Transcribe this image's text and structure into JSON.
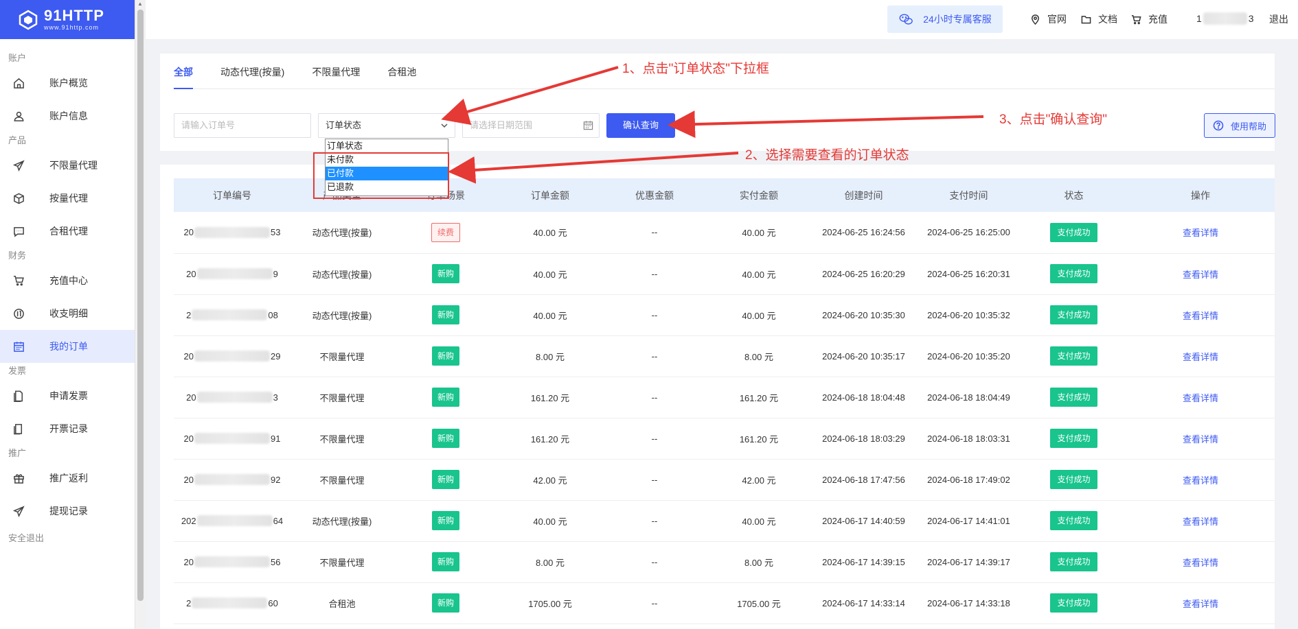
{
  "brand": {
    "name": "91HTTP",
    "url_text": "www.91http.com"
  },
  "topbar": {
    "service": "24小时专属客服",
    "links": [
      "官网",
      "文档",
      "充值"
    ],
    "user_id_start": "1",
    "user_id_end": "3",
    "logout": "退出"
  },
  "sidebar": {
    "groups": [
      {
        "label": "账户",
        "items": [
          {
            "label": "账户概览",
            "icon": "home-icon"
          },
          {
            "label": "账户信息",
            "icon": "user-icon"
          }
        ]
      },
      {
        "label": "产品",
        "items": [
          {
            "label": "不限量代理",
            "icon": "send-icon"
          },
          {
            "label": "按量代理",
            "icon": "box-icon"
          },
          {
            "label": "合租代理",
            "icon": "chat-icon"
          }
        ]
      },
      {
        "label": "财务",
        "items": [
          {
            "label": "充值中心",
            "icon": "cart-icon"
          },
          {
            "label": "收支明细",
            "icon": "coin-icon"
          },
          {
            "label": "我的订单",
            "icon": "calendar-icon",
            "active": true
          }
        ]
      },
      {
        "label": "发票",
        "items": [
          {
            "label": "申请发票",
            "icon": "doc-icon"
          },
          {
            "label": "开票记录",
            "icon": "record-icon"
          }
        ]
      },
      {
        "label": "推广",
        "items": [
          {
            "label": "推广返利",
            "icon": "gift-icon"
          },
          {
            "label": "提现记录",
            "icon": "send-icon"
          }
        ]
      }
    ],
    "footer": "安全退出"
  },
  "tabs": [
    "全部",
    "动态代理(按量)",
    "不限量代理",
    "合租池"
  ],
  "filters": {
    "order_no_placeholder": "请输入订单号",
    "status_value": "订单状态",
    "date_placeholder": "请选择日期范围",
    "confirm": "确认查询",
    "help": "使用帮助"
  },
  "dropdown": {
    "options": [
      "订单状态",
      "未付款",
      "已付款",
      "已退款"
    ],
    "selected_index": 2
  },
  "annotations": {
    "step1": "1、点击\"订单状态\"下拉框",
    "step2": "2、选择需要查看的订单状态",
    "step3": "3、点击\"确认查询\""
  },
  "table": {
    "columns": [
      "订单编号",
      "产品类型",
      "订单场景",
      "订单金额",
      "优惠金额",
      "实付金额",
      "创建时间",
      "支付时间",
      "状态",
      "操作"
    ],
    "rows": [
      {
        "no_start": "20",
        "no_end": "53",
        "product": "动态代理(按量)",
        "scene": "续费",
        "amount": "40.00 元",
        "discount": "--",
        "paid": "40.00 元",
        "created": "2024-06-25 16:24:56",
        "pay_time": "2024-06-25 16:25:00",
        "status": "支付成功",
        "action": "查看详情"
      },
      {
        "no_start": "20",
        "no_end": "9",
        "product": "动态代理(按量)",
        "scene": "新购",
        "amount": "40.00 元",
        "discount": "--",
        "paid": "40.00 元",
        "created": "2024-06-25 16:20:29",
        "pay_time": "2024-06-25 16:20:31",
        "status": "支付成功",
        "action": "查看详情"
      },
      {
        "no_start": "2",
        "no_end": "08",
        "product": "动态代理(按量)",
        "scene": "新购",
        "amount": "40.00 元",
        "discount": "--",
        "paid": "40.00 元",
        "created": "2024-06-20 10:35:30",
        "pay_time": "2024-06-20 10:35:32",
        "status": "支付成功",
        "action": "查看详情"
      },
      {
        "no_start": "20",
        "no_end": "29",
        "product": "不限量代理",
        "scene": "新购",
        "amount": "8.00 元",
        "discount": "--",
        "paid": "8.00 元",
        "created": "2024-06-20 10:35:17",
        "pay_time": "2024-06-20 10:35:20",
        "status": "支付成功",
        "action": "查看详情"
      },
      {
        "no_start": "20",
        "no_end": "3",
        "product": "不限量代理",
        "scene": "新购",
        "amount": "161.20 元",
        "discount": "--",
        "paid": "161.20 元",
        "created": "2024-06-18 18:04:48",
        "pay_time": "2024-06-18 18:04:49",
        "status": "支付成功",
        "action": "查看详情"
      },
      {
        "no_start": "20",
        "no_end": "91",
        "product": "不限量代理",
        "scene": "新购",
        "amount": "161.20 元",
        "discount": "--",
        "paid": "161.20 元",
        "created": "2024-06-18 18:03:29",
        "pay_time": "2024-06-18 18:03:31",
        "status": "支付成功",
        "action": "查看详情"
      },
      {
        "no_start": "20",
        "no_end": "92",
        "product": "不限量代理",
        "scene": "新购",
        "amount": "42.00 元",
        "discount": "--",
        "paid": "42.00 元",
        "created": "2024-06-18 17:47:56",
        "pay_time": "2024-06-18 17:49:02",
        "status": "支付成功",
        "action": "查看详情"
      },
      {
        "no_start": "202",
        "no_end": "64",
        "product": "动态代理(按量)",
        "scene": "新购",
        "amount": "40.00 元",
        "discount": "--",
        "paid": "40.00 元",
        "created": "2024-06-17 14:40:59",
        "pay_time": "2024-06-17 14:41:01",
        "status": "支付成功",
        "action": "查看详情"
      },
      {
        "no_start": "20",
        "no_end": "56",
        "product": "不限量代理",
        "scene": "新购",
        "amount": "8.00 元",
        "discount": "--",
        "paid": "8.00 元",
        "created": "2024-06-17 14:39:15",
        "pay_time": "2024-06-17 14:39:17",
        "status": "支付成功",
        "action": "查看详情"
      },
      {
        "no_start": "2",
        "no_end": "60",
        "product": "合租池",
        "scene": "新购",
        "amount": "1705.00 元",
        "discount": "--",
        "paid": "1705.00 元",
        "created": "2024-06-17 14:33:14",
        "pay_time": "2024-06-17 14:33:18",
        "status": "支付成功",
        "action": "查看详情"
      }
    ]
  },
  "colors": {
    "brand": "#3d5af1",
    "success": "#19c48d",
    "annotation": "#e53935"
  }
}
